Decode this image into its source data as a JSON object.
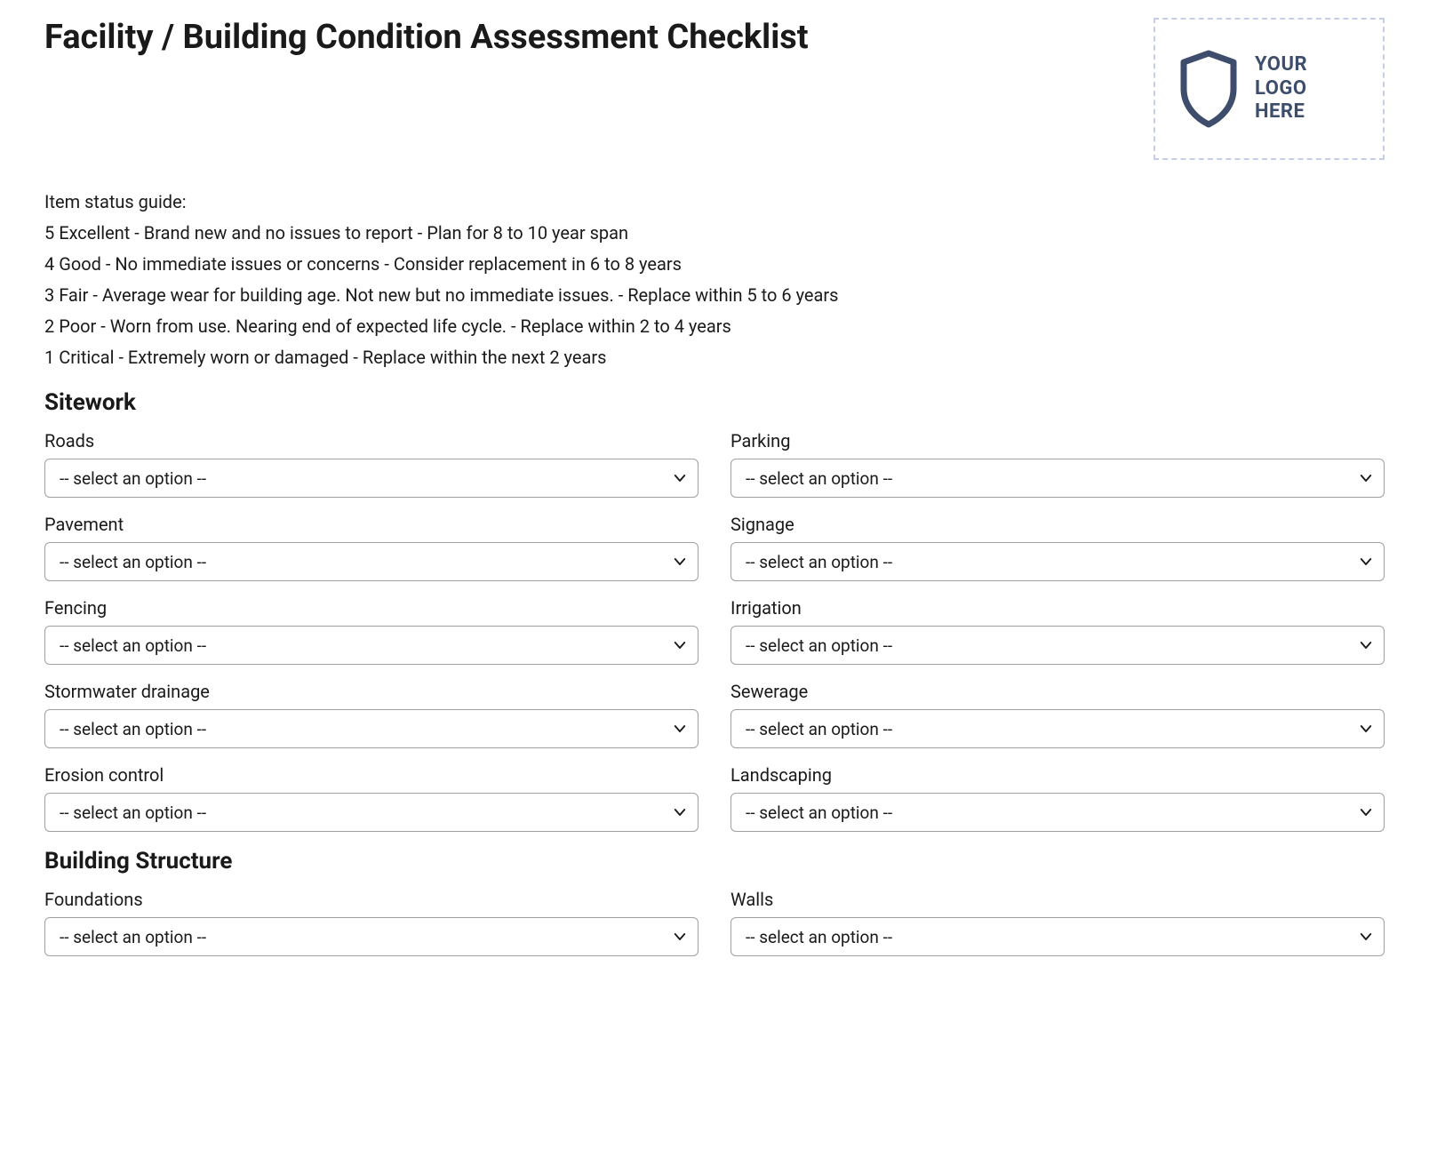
{
  "header": {
    "title": "Facility / Building Condition Assessment Checklist",
    "logo_text": "YOUR\nLOGO\nHERE"
  },
  "status_guide": {
    "heading": "Item status guide:",
    "items": [
      "5 Excellent - Brand new and no issues to report - Plan for 8 to 10 year span",
      "4 Good - No immediate issues or concerns - Consider replacement in 6 to 8 years",
      "3 Fair - Average wear for building age. Not new but no immediate issues. - Replace within 5 to 6 years",
      "2 Poor - Worn from use. Nearing end of expected life cycle. - Replace within 2 to 4 years",
      "1 Critical - Extremely worn or damaged - Replace within the next 2 years"
    ]
  },
  "select_placeholder": "-- select an option --",
  "sections": {
    "sitework": {
      "title": "Sitework",
      "fields": [
        {
          "label": "Roads"
        },
        {
          "label": "Parking"
        },
        {
          "label": "Pavement"
        },
        {
          "label": "Signage"
        },
        {
          "label": "Fencing"
        },
        {
          "label": "Irrigation"
        },
        {
          "label": "Stormwater drainage"
        },
        {
          "label": "Sewerage"
        },
        {
          "label": "Erosion control"
        },
        {
          "label": "Landscaping"
        }
      ]
    },
    "building_structure": {
      "title": "Building Structure",
      "fields": [
        {
          "label": "Foundations"
        },
        {
          "label": "Walls"
        }
      ]
    }
  }
}
